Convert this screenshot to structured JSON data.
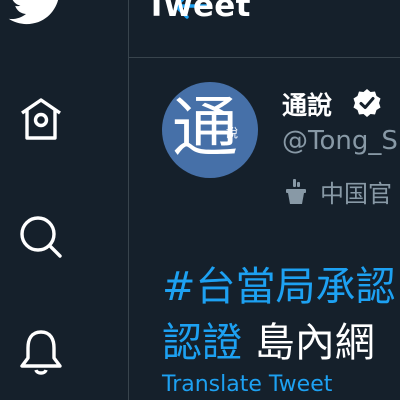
{
  "header": {
    "title": "Tweet"
  },
  "nav": {
    "items": [
      {
        "icon": "twitter-logo-icon"
      },
      {
        "icon": "home-icon"
      },
      {
        "icon": "search-icon"
      },
      {
        "icon": "notifications-icon"
      }
    ]
  },
  "tweet": {
    "author": {
      "display_name": "通說",
      "handle": "@Tong_S",
      "avatar_char": "通",
      "avatar_small": "說",
      "verified": true,
      "label": "中国官"
    },
    "line1": "#台當局承認",
    "line2_hashtag": "認證",
    "line2_text": " 島內網",
    "translate_label": "Translate Tweet"
  },
  "colors": {
    "background": "#15202b",
    "accent": "#1da1f2",
    "secondary_text": "#8899a6",
    "divider": "#38444d"
  }
}
